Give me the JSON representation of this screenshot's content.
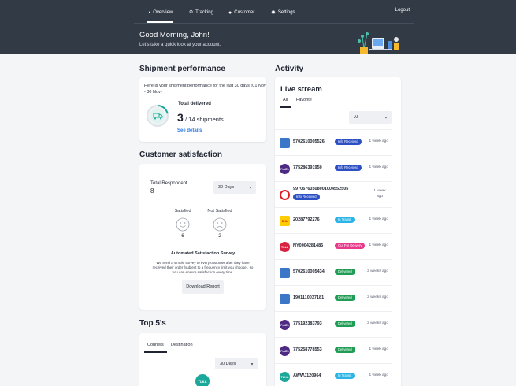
{
  "nav": {
    "items": [
      {
        "label": "Overview",
        "icon": "dashboard-icon",
        "active": true
      },
      {
        "label": "Tracking",
        "icon": "location-pin-icon"
      },
      {
        "label": "Customer",
        "icon": "person-icon"
      },
      {
        "label": "Settings",
        "icon": "gear-icon"
      }
    ],
    "logout": "Logout"
  },
  "welcome": {
    "greeting": "Good Morning, John!",
    "subtitle": "Let's take a quick look at your account."
  },
  "shipment": {
    "title": "Shipment performance",
    "description": "Here is your shipment performance for the last 30 days (01 Nov - 30 Nov)",
    "total_label": "Total delivered",
    "delivered": "3",
    "of_label": "/ 14 shipments",
    "delivered_fraction": 0.214,
    "see_details": "See details"
  },
  "satisfaction": {
    "title": "Customer satisfaction",
    "respondent_label": "Total Respondent",
    "respondent_count": "8",
    "period": "30 Days",
    "satisfied_label": "Satisfied",
    "satisfied_count": "6",
    "not_satisfied_label": "Not Satisfied",
    "not_satisfied_count": "2",
    "survey_title": "Automated Satisfaction Survey",
    "survey_desc": "We send a simple survey to every customer after they have received their order (subject to a frequency limit you choose), so you can ensure satisfaction every time.",
    "download_label": "Download Report"
  },
  "top5": {
    "title": "Top 5's",
    "tabs": [
      "Couriers",
      "Destination"
    ],
    "period": "30 Days",
    "courier_logo_text": "TUKA"
  },
  "activity": {
    "title": "Activity",
    "stream_title": "Live stream",
    "tabs": [
      "All",
      "Favorite"
    ],
    "filter": "All",
    "rows": [
      {
        "courier": "dhl-express",
        "logo_color": "#3b76c9",
        "tracking": "5702610005526",
        "status": "Info Received",
        "status_color": "#2d4fc4",
        "time": "1 week ago"
      },
      {
        "courier": "fedex",
        "logo_color": "#4d2a84",
        "tracking": "775286391950",
        "status": "Info Received",
        "status_color": "#2d4fc4",
        "time": "1 week ago"
      },
      {
        "courier": "australia-post",
        "logo_color": "#e21b23",
        "tracking": "99705763508001004552505",
        "status": "Info Received",
        "status_color": "#2d4fc4",
        "time": "1 week ago"
      },
      {
        "courier": "dhl",
        "logo_color": "#ffcc00",
        "tracking": "20287792276",
        "status": "In Transit",
        "status_color": "#2bb5e6",
        "time": "1 week ago"
      },
      {
        "courier": "toll",
        "logo_color": "#d9223f",
        "tracking": "NY0004281485",
        "status": "Out For Delivery",
        "status_color": "#e83a8a",
        "time": "1 week ago"
      },
      {
        "courier": "dhl-express",
        "logo_color": "#3b76c9",
        "tracking": "5702610005434",
        "status": "Delivered",
        "status_color": "#1f9d55",
        "time": "2 weeks ago"
      },
      {
        "courier": "dhl-express",
        "logo_color": "#3b76c9",
        "tracking": "1901110037181",
        "status": "Delivered",
        "status_color": "#1f9d55",
        "time": "2 weeks ago"
      },
      {
        "courier": "fedex",
        "logo_color": "#4d2a84",
        "tracking": "775192383793",
        "status": "Delivered",
        "status_color": "#1f9d55",
        "time": "2 weeks ago"
      },
      {
        "courier": "fedex",
        "logo_color": "#4d2a84",
        "tracking": "775258778553",
        "status": "Delivered",
        "status_color": "#1f9d55",
        "time": "1 week ago"
      },
      {
        "courier": "tuka",
        "logo_color": "#1aa89a",
        "tracking": "AWWJ120964",
        "status": "In Transit",
        "status_color": "#2bb5e6",
        "time": "1 week ago"
      }
    ]
  }
}
